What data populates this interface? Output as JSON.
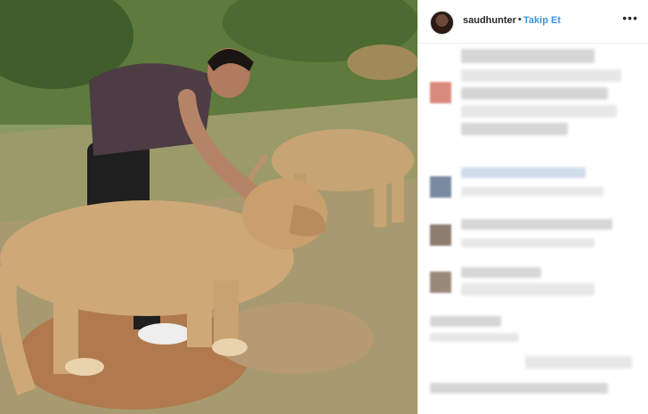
{
  "post": {
    "username": "saudhunter",
    "separator": "•",
    "follow_label": "Takip Et",
    "more_label": "•••"
  },
  "icons": {
    "avatar": "user-avatar",
    "more": "more-options-icon"
  },
  "colors": {
    "follow": "#3897f0",
    "text": "#262626",
    "divider": "#efefef"
  }
}
